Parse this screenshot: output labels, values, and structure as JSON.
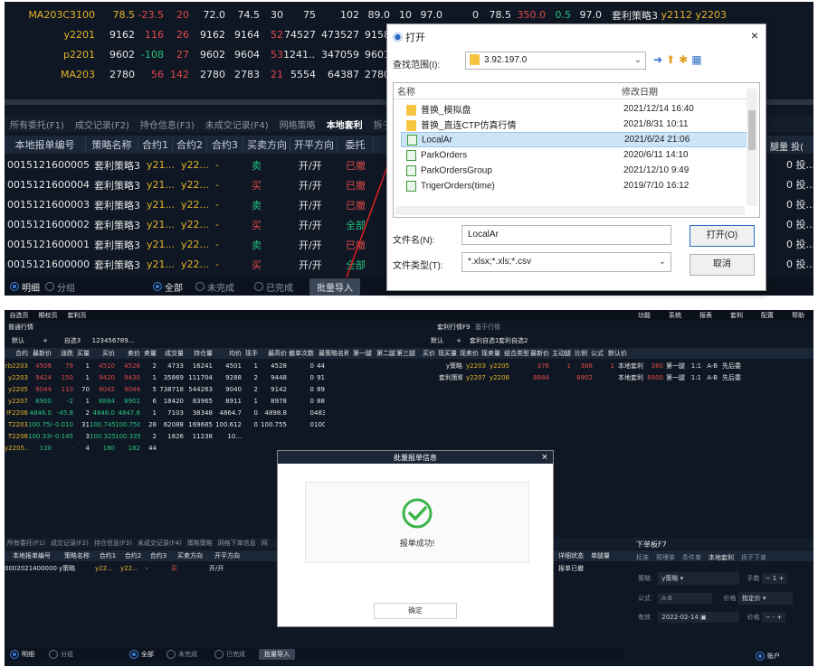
{
  "quotes": [
    {
      "sym": "MA203C3100",
      "c": [
        "78.5",
        "-23.5",
        "20",
        "72.0",
        "74.5",
        "30",
        "75",
        "102",
        "89.0",
        "10",
        "97.0",
        "0",
        "78.5",
        "350.0",
        "0.5",
        "97.0",
        "套利策略3",
        "y2112",
        "y2203"
      ]
    },
    {
      "sym": "y2201",
      "c": [
        "9162",
        "116",
        "26",
        "9162",
        "9164",
        "52",
        "74527",
        "473527",
        "9158"
      ]
    },
    {
      "sym": "p2201",
      "c": [
        "9602",
        "-108",
        "27",
        "9602",
        "9604",
        "53",
        "1241...",
        "347059",
        "9601"
      ]
    },
    {
      "sym": "MA203",
      "c": [
        "2780",
        "56",
        "142",
        "2780",
        "2783",
        "21",
        "5554",
        "64387",
        "2780"
      ]
    }
  ],
  "top_tabs": [
    "所有委托(F1)",
    "成交记录(F2)",
    "持仓信息(F3)",
    "未成交记录(F4)",
    "网格策略",
    "本地套利",
    "拆子下"
  ],
  "top_active_tab": "本地套利",
  "order_headers": [
    "本地报单编号",
    "策略名称",
    "合约1",
    "合约2",
    "合约3",
    "买卖方向",
    "开平方向",
    "委托"
  ],
  "orders": [
    {
      "id": "0015121600005",
      "strat": "套利策略3",
      "c1": "y21...",
      "c2": "y22...",
      "c3": "-",
      "side": "卖",
      "oc": "开/开",
      "st": "已撤"
    },
    {
      "id": "0015121600004",
      "strat": "套利策略3",
      "c1": "y21...",
      "c2": "y22...",
      "c3": "-",
      "side": "买",
      "oc": "开/开",
      "st": "已撤"
    },
    {
      "id": "0015121600003",
      "strat": "套利策略3",
      "c1": "y21...",
      "c2": "y22...",
      "c3": "-",
      "side": "卖",
      "oc": "开/开",
      "st": "已撤"
    },
    {
      "id": "0015121600002",
      "strat": "套利策略3",
      "c1": "y21...",
      "c2": "y22...",
      "c3": "-",
      "side": "买",
      "oc": "开/开",
      "st": "全部"
    },
    {
      "id": "0015121600001",
      "strat": "套利策略3",
      "c1": "y21...",
      "c2": "y22...",
      "c3": "-",
      "side": "卖",
      "oc": "开/开",
      "st": "已撤"
    },
    {
      "id": "0015121600000",
      "strat": "套利策略3",
      "c1": "y21...",
      "c2": "y22...",
      "c3": "-",
      "side": "买",
      "oc": "开/开",
      "st": "全部"
    }
  ],
  "right_edge": {
    "hdr": "腿量 投(",
    "vals": [
      "0 投...",
      "0 投...",
      "0 投...",
      "0 投...",
      "0 投...",
      "0 投..."
    ]
  },
  "top_footer": {
    "r1": "明细",
    "r2": "分组",
    "r3": "全部",
    "r4": "未完成",
    "r5": "已完成",
    "btn": "批量导入"
  },
  "file_dialog": {
    "title": "打开",
    "lookin_label": "查找范围(I):",
    "lookin_value": "3.92.197.0",
    "col_name": "名称",
    "col_date": "修改日期",
    "files": [
      {
        "name": "普换_模拟盘",
        "date": "2021/12/14 16:40",
        "type": "folder"
      },
      {
        "name": "普换_直连CTP仿真行情",
        "date": "2021/8/31 10:11",
        "type": "folder"
      },
      {
        "name": "LocalAr",
        "date": "2021/6/24 21:06",
        "type": "xls",
        "selected": true
      },
      {
        "name": "ParkOrders",
        "date": "2020/6/11 14:10",
        "type": "xls"
      },
      {
        "name": "ParkOrdersGroup",
        "date": "2021/12/10 9:49",
        "type": "xls"
      },
      {
        "name": "TrigerOrders(time)",
        "date": "2019/7/10 16:12",
        "type": "xls"
      }
    ],
    "filename_label": "文件名(N):",
    "filename_value": "LocalAr",
    "filetype_label": "文件类型(T):",
    "filetype_value": "*.xlsx;*.xls;*.csv",
    "open_btn": "打开(O)",
    "cancel_btn": "取消",
    "close": "×"
  },
  "bottom": {
    "menu": [
      "自选页",
      "期权页",
      "套利页"
    ],
    "menu_right": [
      "功能",
      "系统",
      "报表",
      "套利",
      "配置",
      "帮助"
    ],
    "section_left": "普通行情",
    "section_mid": "套利行情F9",
    "section_mid2": "基于行情",
    "tabs_left": [
      "默认",
      "+",
      "自选3",
      "123456789..."
    ],
    "tabs_mid": [
      "默认",
      "+",
      "套利自选1",
      "套利自选2"
    ],
    "hdr_left": [
      "合约",
      "最新价",
      "涨跌",
      "买量",
      "买价",
      "卖价",
      "卖量",
      "成交量",
      "持仓量",
      "均价",
      "现手",
      "最高价",
      "撤单次数",
      "最"
    ],
    "hdr_mid": [
      "策略名称",
      "第一腿",
      "第二腿",
      "第三腿",
      "买价",
      "现买量",
      "现卖价",
      "现卖量",
      "组合类型",
      "最新价",
      "主动腿",
      "比例",
      "公式",
      "默认价"
    ],
    "left_rows": [
      [
        "rb2203",
        "4509",
        "79",
        "1",
        "4510",
        "4528",
        "2",
        "4733",
        "16241",
        "4501",
        "1",
        "4528",
        "0",
        "44"
      ],
      [
        "y2203",
        "9424",
        "150",
        "1",
        "9420",
        "9430",
        "1",
        "35869",
        "111704",
        "9288",
        "2",
        "9448",
        "0",
        "91"
      ],
      [
        "y2205",
        "9044",
        "110",
        "70",
        "9042",
        "9044",
        "5",
        "738718",
        "544263",
        "9040",
        "2",
        "9142",
        "0",
        "89"
      ],
      [
        "y2207",
        "8900",
        "-2",
        "1",
        "8884",
        "8902",
        "6",
        "18420",
        "83965",
        "8911",
        "1",
        "8978",
        "0",
        "88"
      ],
      [
        "IF2206",
        "4846.0",
        "-45.8",
        "2",
        "4846.0",
        "4847.8",
        "1",
        "7103",
        "38348",
        "4864.7",
        "0",
        "4898.8",
        "0",
        "483"
      ],
      [
        "T2203",
        "100.750",
        "-0.010",
        "31",
        "100.745",
        "100.750",
        "28",
        "62088",
        "169685",
        "100.612",
        "0",
        "100.755",
        "0",
        "100.5"
      ],
      [
        "T2206",
        "100.330",
        "-0.145",
        "3",
        "100.325",
        "100.335",
        "2",
        "1826",
        "11238",
        "10..."
      ],
      [
        "y2205...",
        "130",
        "-",
        "4",
        "180",
        "182",
        "44"
      ]
    ],
    "mid_rows": [
      [
        "y策略",
        "y2203",
        "y2205",
        "",
        "376",
        "1",
        "388",
        "1",
        "本地套利",
        "380",
        "第一腿",
        "1:1",
        "A-B",
        "先后委"
      ],
      [
        "套利策略1",
        "y2207",
        "y2208",
        "",
        "8884",
        "",
        "8902",
        "",
        "本地套利",
        "8900",
        "第一腿",
        "1:1",
        "A-B",
        "先后委"
      ]
    ],
    "low_tabs": [
      "所有委托(F1)",
      "成交记录(F2)",
      "持仓信息(F3)",
      "未成交记录(F4)",
      "策略策略",
      "网格下单信息",
      "网"
    ],
    "low_hdr": [
      "本地报单编号",
      "策略名称",
      "合约1",
      "合约2",
      "合约3",
      "买卖方向",
      "开平方向"
    ],
    "low_row": [
      "0002021400000",
      "y策略",
      "y22...",
      "y22...",
      "-",
      "买",
      "开/开"
    ],
    "low_mid_hdr": [
      "详细状态",
      "单腿量"
    ],
    "low_mid_val": "报单已撤",
    "order_panel": {
      "title": "下单板F7",
      "tabs": [
        "标准",
        "预埋单",
        "条件单",
        "本地套利",
        "拆子下单"
      ],
      "strategy_label": "策略",
      "strategy_val": "y策略",
      "vol_label": "手数",
      "vol_val": "1",
      "formula_label": "公式",
      "formula_val": "A-B",
      "price_type_label": "价格",
      "price_type_val": "指定价",
      "date_label": "有效",
      "date_val": "2022-02-14",
      "price_label": "价格",
      "price_val": "-",
      "acct_label": "账户"
    },
    "foot": {
      "r1": "明细",
      "r2": "分组",
      "r3": "全部",
      "r4": "未完成",
      "r5": "已完成",
      "btn": "批量导入"
    }
  },
  "modal": {
    "title": "批量报单信息",
    "message": "报单成功!",
    "ok": "确定",
    "close": "×"
  },
  "colors": {
    "up": "#e24a4a",
    "down": "#27c37e",
    "accent": "#3a7bd5",
    "bg": "#0f1724",
    "success": "#3ab54a"
  }
}
